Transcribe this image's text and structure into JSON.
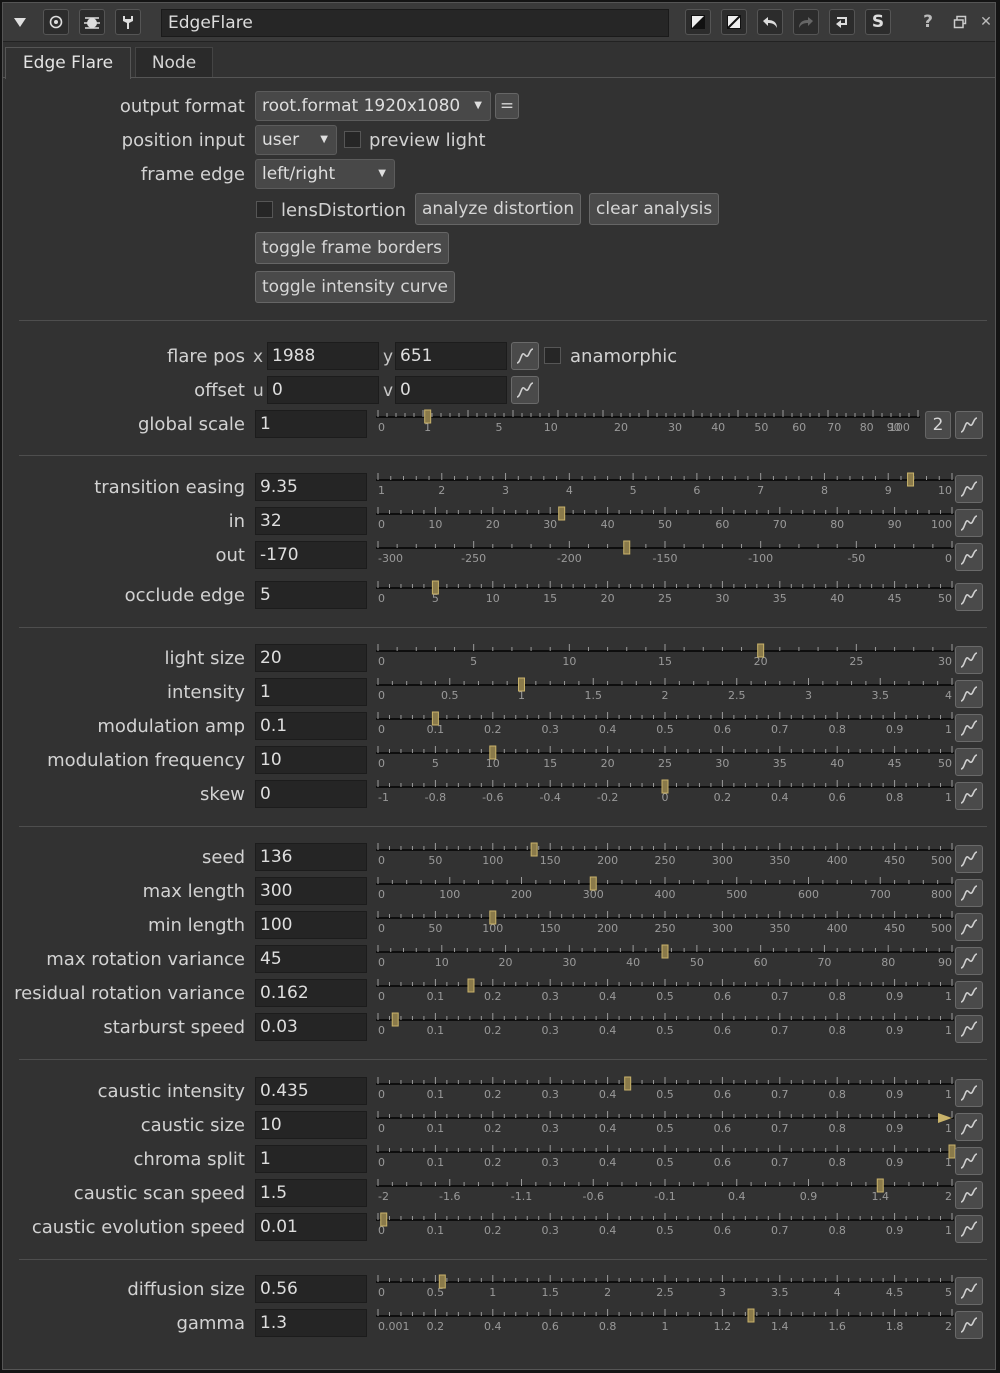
{
  "node_title": "EdgeFlare",
  "titlebar_icons": {
    "left": [
      "collapse-triangle-icon",
      "viewer-circle-icon",
      "bug-icon",
      "wrench-icon"
    ],
    "right": [
      "color-swatch-icon",
      "color-swatch-alt-icon",
      "undo-icon",
      "redo-icon",
      "revert-icon",
      "script-s-icon",
      "help-icon",
      "float-window-icon",
      "close-icon"
    ],
    "help": "?",
    "close": "✕",
    "script": "S"
  },
  "tabs": [
    {
      "label": "Edge Flare",
      "active": true
    },
    {
      "label": "Node",
      "active": false
    }
  ],
  "header": {
    "output_format": {
      "label": "output format",
      "value": "root.format 1920x1080",
      "extra_button": "="
    },
    "position_input": {
      "label": "position input",
      "value": "user",
      "preview_label": "preview light",
      "preview_checked": false
    },
    "frame_edge": {
      "label": "frame edge",
      "value": "left/right"
    },
    "lens": {
      "label": "lensDistortion",
      "checked": false,
      "analyze": "analyze distortion",
      "clear": "clear analysis"
    },
    "toggle_borders": "toggle frame borders",
    "toggle_curve": "toggle intensity curve"
  },
  "flare_pos": {
    "label": "flare pos",
    "x_label": "x",
    "x": "1988",
    "y_label": "y",
    "y": "651",
    "anamorphic": "anamorphic",
    "anamorphic_checked": false
  },
  "offset": {
    "label": "offset",
    "u_label": "u",
    "u": "0",
    "v_label": "v",
    "v": "0"
  },
  "global_scale": {
    "label": "global scale",
    "value": "1",
    "dim_button": "2",
    "value_num": 1,
    "ticks": [
      {
        "v": 0,
        "t": "0"
      },
      {
        "v": 1,
        "t": "1"
      },
      {
        "v": 5,
        "t": "5"
      },
      {
        "v": 10,
        "t": "10"
      },
      {
        "v": 20,
        "t": "20"
      },
      {
        "v": 30,
        "t": "30"
      },
      {
        "v": 40,
        "t": "40"
      },
      {
        "v": 50,
        "t": "50"
      },
      {
        "v": 60,
        "t": "60"
      },
      {
        "v": 70,
        "t": "70"
      },
      {
        "v": 80,
        "t": "80"
      },
      {
        "v": 90,
        "t": "90"
      },
      {
        "v": 100,
        "t": "100"
      }
    ]
  },
  "groups": [
    {
      "rows": [
        {
          "label": "transition easing",
          "value": "9.35",
          "min": 1,
          "max": 10,
          "num": 9.35,
          "ticks": [
            "1",
            "2",
            "3",
            "4",
            "5",
            "6",
            "7",
            "8",
            "9",
            "10"
          ]
        },
        {
          "label": "in",
          "value": "32",
          "min": 0,
          "max": 100,
          "num": 32,
          "ticks": [
            "0",
            "10",
            "20",
            "30",
            "40",
            "50",
            "60",
            "70",
            "80",
            "90",
            "100"
          ]
        },
        {
          "label": "out",
          "value": "-170",
          "min": -300,
          "max": 0,
          "num": -170,
          "ticks": [
            "-300",
            "-250",
            "-200",
            "-150",
            "-100",
            "-50",
            "0"
          ]
        },
        {
          "label": "occlude edge",
          "value": "5",
          "min": 0,
          "max": 50,
          "num": 5,
          "ticks": [
            "0",
            "5",
            "10",
            "15",
            "20",
            "25",
            "30",
            "35",
            "40",
            "45",
            "50"
          ],
          "gap": true
        }
      ]
    },
    {
      "rows": [
        {
          "label": "light size",
          "value": "20",
          "min": 0,
          "max": 30,
          "num": 20,
          "ticks": [
            "0",
            "5",
            "10",
            "15",
            "20",
            "25",
            "30"
          ]
        },
        {
          "label": "intensity",
          "value": "1",
          "min": 0,
          "max": 4,
          "num": 1,
          "ticks": [
            "0",
            "0.5",
            "1",
            "1.5",
            "2",
            "2.5",
            "3",
            "3.5",
            "4"
          ]
        },
        {
          "label": "modulation amp",
          "value": "0.1",
          "min": 0,
          "max": 1,
          "num": 0.1,
          "ticks": [
            "0",
            "0.1",
            "0.2",
            "0.3",
            "0.4",
            "0.5",
            "0.6",
            "0.7",
            "0.8",
            "0.9",
            "1"
          ]
        },
        {
          "label": "modulation frequency",
          "value": "10",
          "min": 0,
          "max": 50,
          "num": 10,
          "ticks": [
            "0",
            "5",
            "10",
            "15",
            "20",
            "25",
            "30",
            "35",
            "40",
            "45",
            "50"
          ]
        },
        {
          "label": "skew",
          "value": "0",
          "min": -1,
          "max": 1,
          "num": 0,
          "ticks": [
            "-1",
            "-0.8",
            "-0.6",
            "-0.4",
            "-0.2",
            "0",
            "0.2",
            "0.4",
            "0.6",
            "0.8",
            "1"
          ]
        }
      ]
    },
    {
      "rows": [
        {
          "label": "seed",
          "value": "136",
          "min": 0,
          "max": 500,
          "num": 136,
          "ticks": [
            "0",
            "50",
            "100",
            "150",
            "200",
            "250",
            "300",
            "350",
            "400",
            "450",
            "500"
          ]
        },
        {
          "label": "max length",
          "value": "300",
          "min": 0,
          "max": 800,
          "num": 300,
          "ticks": [
            "0",
            "100",
            "200",
            "300",
            "400",
            "500",
            "600",
            "700",
            "800"
          ]
        },
        {
          "label": "min length",
          "value": "100",
          "min": 0,
          "max": 500,
          "num": 100,
          "ticks": [
            "0",
            "50",
            "100",
            "150",
            "200",
            "250",
            "300",
            "350",
            "400",
            "450",
            "500"
          ]
        },
        {
          "label": "max rotation variance",
          "value": "45",
          "min": 0,
          "max": 90,
          "num": 45,
          "ticks": [
            "0",
            "10",
            "20",
            "30",
            "40",
            "50",
            "60",
            "70",
            "80",
            "90"
          ]
        },
        {
          "label": "residual rotation variance",
          "value": "0.162",
          "min": 0,
          "max": 1,
          "num": 0.162,
          "ticks": [
            "0",
            "0.1",
            "0.2",
            "0.3",
            "0.4",
            "0.5",
            "0.6",
            "0.7",
            "0.8",
            "0.9",
            "1"
          ]
        },
        {
          "label": "starburst speed",
          "value": "0.03",
          "min": 0,
          "max": 1,
          "num": 0.03,
          "ticks": [
            "0",
            "0.1",
            "0.2",
            "0.3",
            "0.4",
            "0.5",
            "0.6",
            "0.7",
            "0.8",
            "0.9",
            "1"
          ]
        }
      ]
    },
    {
      "rows": [
        {
          "label": "caustic intensity",
          "value": "0.435",
          "min": 0,
          "max": 1,
          "num": 0.435,
          "ticks": [
            "0",
            "0.1",
            "0.2",
            "0.3",
            "0.4",
            "0.5",
            "0.6",
            "0.7",
            "0.8",
            "0.9",
            "1"
          ]
        },
        {
          "label": "caustic size",
          "value": "10",
          "min": 0,
          "max": 1,
          "num": 1,
          "arrow": true,
          "ticks": [
            "0",
            "0.1",
            "0.2",
            "0.3",
            "0.4",
            "0.5",
            "0.6",
            "0.7",
            "0.8",
            "0.9",
            "1"
          ]
        },
        {
          "label": "chroma split",
          "value": "1",
          "min": 0,
          "max": 1,
          "num": 1,
          "ticks": [
            "0",
            "0.1",
            "0.2",
            "0.3",
            "0.4",
            "0.5",
            "0.6",
            "0.7",
            "0.8",
            "0.9",
            "1"
          ]
        },
        {
          "label": "caustic scan speed",
          "value": "1.5",
          "min": -2,
          "max": 2,
          "num": 1.5,
          "ticks": [
            "-2",
            "-1.6",
            "-1.1",
            "-0.6",
            "-0.1",
            "0.4",
            "0.9",
            "1.4",
            "2"
          ]
        },
        {
          "label": "caustic evolution speed",
          "value": "0.01",
          "min": 0,
          "max": 1,
          "num": 0.01,
          "ticks": [
            "0",
            "0.1",
            "0.2",
            "0.3",
            "0.4",
            "0.5",
            "0.6",
            "0.7",
            "0.8",
            "0.9",
            "1"
          ]
        }
      ]
    },
    {
      "rows": [
        {
          "label": "diffusion size",
          "value": "0.56",
          "min": 0,
          "max": 5,
          "num": 0.56,
          "ticks": [
            "0",
            "0.5",
            "1",
            "1.5",
            "2",
            "2.5",
            "3",
            "3.5",
            "4",
            "4.5",
            "5"
          ]
        },
        {
          "label": "gamma",
          "value": "1.3",
          "min": 0.001,
          "max": 2,
          "num": 1.3,
          "ticks": [
            "0.001",
            "0.2",
            "0.4",
            "0.6",
            "0.8",
            "1",
            "1.2",
            "1.4",
            "1.6",
            "1.8",
            "2"
          ]
        }
      ]
    }
  ],
  "colors": {
    "panel": "#323232",
    "field": "#252525",
    "handle": "#8a7a4a",
    "accent": "#c9b36a"
  }
}
